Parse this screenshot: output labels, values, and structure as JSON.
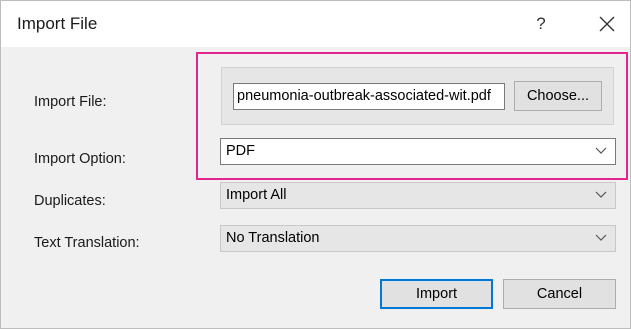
{
  "dialog": {
    "title": "Import File",
    "help_label": "?",
    "close_icon": "close-icon"
  },
  "form": {
    "import_file_label": "Import File:",
    "import_file_value": "pneumonia-outbreak-associated-wit.pdf",
    "choose_label": "Choose...",
    "import_option_label": "Import Option:",
    "import_option_value": "PDF",
    "duplicates_label": "Duplicates:",
    "duplicates_value": "Import All",
    "text_translation_label": "Text Translation:",
    "text_translation_value": "No Translation"
  },
  "actions": {
    "import_label": "Import",
    "cancel_label": "Cancel"
  },
  "colors": {
    "highlight": "#e3268f",
    "default_button_border": "#0078d7",
    "dialog_background": "#f0f0f0"
  }
}
